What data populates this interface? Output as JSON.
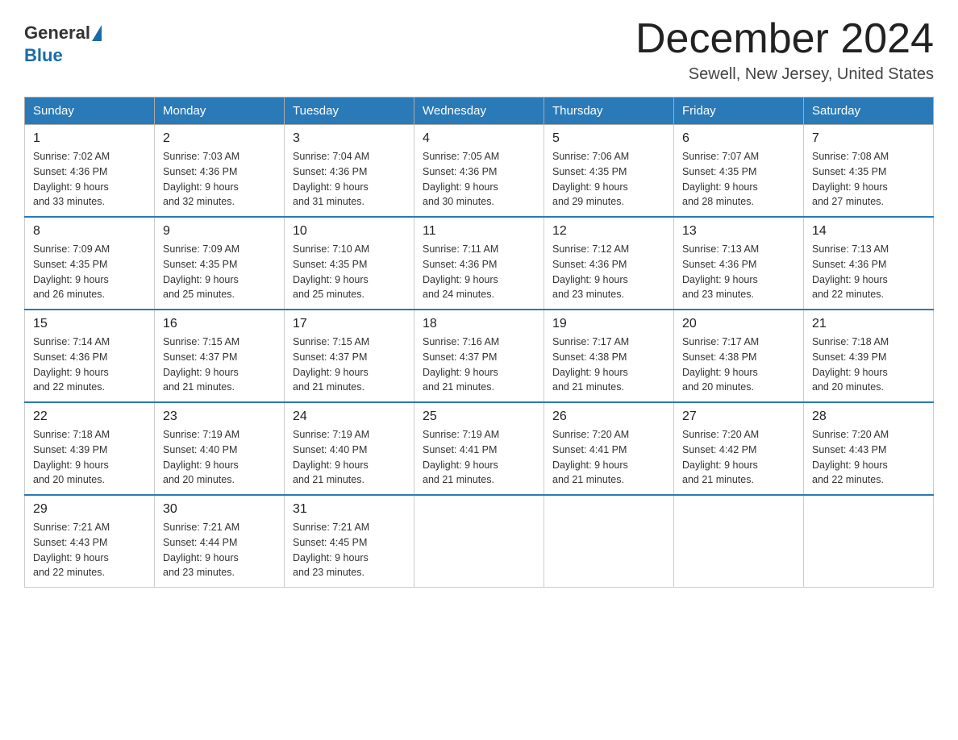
{
  "header": {
    "logo_general": "General",
    "logo_blue": "Blue",
    "month_title": "December 2024",
    "location": "Sewell, New Jersey, United States"
  },
  "calendar": {
    "days_of_week": [
      "Sunday",
      "Monday",
      "Tuesday",
      "Wednesday",
      "Thursday",
      "Friday",
      "Saturday"
    ],
    "weeks": [
      [
        {
          "day": "1",
          "sunrise": "7:02 AM",
          "sunset": "4:36 PM",
          "daylight": "9 hours and 33 minutes."
        },
        {
          "day": "2",
          "sunrise": "7:03 AM",
          "sunset": "4:36 PM",
          "daylight": "9 hours and 32 minutes."
        },
        {
          "day": "3",
          "sunrise": "7:04 AM",
          "sunset": "4:36 PM",
          "daylight": "9 hours and 31 minutes."
        },
        {
          "day": "4",
          "sunrise": "7:05 AM",
          "sunset": "4:36 PM",
          "daylight": "9 hours and 30 minutes."
        },
        {
          "day": "5",
          "sunrise": "7:06 AM",
          "sunset": "4:35 PM",
          "daylight": "9 hours and 29 minutes."
        },
        {
          "day": "6",
          "sunrise": "7:07 AM",
          "sunset": "4:35 PM",
          "daylight": "9 hours and 28 minutes."
        },
        {
          "day": "7",
          "sunrise": "7:08 AM",
          "sunset": "4:35 PM",
          "daylight": "9 hours and 27 minutes."
        }
      ],
      [
        {
          "day": "8",
          "sunrise": "7:09 AM",
          "sunset": "4:35 PM",
          "daylight": "9 hours and 26 minutes."
        },
        {
          "day": "9",
          "sunrise": "7:09 AM",
          "sunset": "4:35 PM",
          "daylight": "9 hours and 25 minutes."
        },
        {
          "day": "10",
          "sunrise": "7:10 AM",
          "sunset": "4:35 PM",
          "daylight": "9 hours and 25 minutes."
        },
        {
          "day": "11",
          "sunrise": "7:11 AM",
          "sunset": "4:36 PM",
          "daylight": "9 hours and 24 minutes."
        },
        {
          "day": "12",
          "sunrise": "7:12 AM",
          "sunset": "4:36 PM",
          "daylight": "9 hours and 23 minutes."
        },
        {
          "day": "13",
          "sunrise": "7:13 AM",
          "sunset": "4:36 PM",
          "daylight": "9 hours and 23 minutes."
        },
        {
          "day": "14",
          "sunrise": "7:13 AM",
          "sunset": "4:36 PM",
          "daylight": "9 hours and 22 minutes."
        }
      ],
      [
        {
          "day": "15",
          "sunrise": "7:14 AM",
          "sunset": "4:36 PM",
          "daylight": "9 hours and 22 minutes."
        },
        {
          "day": "16",
          "sunrise": "7:15 AM",
          "sunset": "4:37 PM",
          "daylight": "9 hours and 21 minutes."
        },
        {
          "day": "17",
          "sunrise": "7:15 AM",
          "sunset": "4:37 PM",
          "daylight": "9 hours and 21 minutes."
        },
        {
          "day": "18",
          "sunrise": "7:16 AM",
          "sunset": "4:37 PM",
          "daylight": "9 hours and 21 minutes."
        },
        {
          "day": "19",
          "sunrise": "7:17 AM",
          "sunset": "4:38 PM",
          "daylight": "9 hours and 21 minutes."
        },
        {
          "day": "20",
          "sunrise": "7:17 AM",
          "sunset": "4:38 PM",
          "daylight": "9 hours and 20 minutes."
        },
        {
          "day": "21",
          "sunrise": "7:18 AM",
          "sunset": "4:39 PM",
          "daylight": "9 hours and 20 minutes."
        }
      ],
      [
        {
          "day": "22",
          "sunrise": "7:18 AM",
          "sunset": "4:39 PM",
          "daylight": "9 hours and 20 minutes."
        },
        {
          "day": "23",
          "sunrise": "7:19 AM",
          "sunset": "4:40 PM",
          "daylight": "9 hours and 20 minutes."
        },
        {
          "day": "24",
          "sunrise": "7:19 AM",
          "sunset": "4:40 PM",
          "daylight": "9 hours and 21 minutes."
        },
        {
          "day": "25",
          "sunrise": "7:19 AM",
          "sunset": "4:41 PM",
          "daylight": "9 hours and 21 minutes."
        },
        {
          "day": "26",
          "sunrise": "7:20 AM",
          "sunset": "4:41 PM",
          "daylight": "9 hours and 21 minutes."
        },
        {
          "day": "27",
          "sunrise": "7:20 AM",
          "sunset": "4:42 PM",
          "daylight": "9 hours and 21 minutes."
        },
        {
          "day": "28",
          "sunrise": "7:20 AM",
          "sunset": "4:43 PM",
          "daylight": "9 hours and 22 minutes."
        }
      ],
      [
        {
          "day": "29",
          "sunrise": "7:21 AM",
          "sunset": "4:43 PM",
          "daylight": "9 hours and 22 minutes."
        },
        {
          "day": "30",
          "sunrise": "7:21 AM",
          "sunset": "4:44 PM",
          "daylight": "9 hours and 23 minutes."
        },
        {
          "day": "31",
          "sunrise": "7:21 AM",
          "sunset": "4:45 PM",
          "daylight": "9 hours and 23 minutes."
        },
        null,
        null,
        null,
        null
      ]
    ]
  }
}
